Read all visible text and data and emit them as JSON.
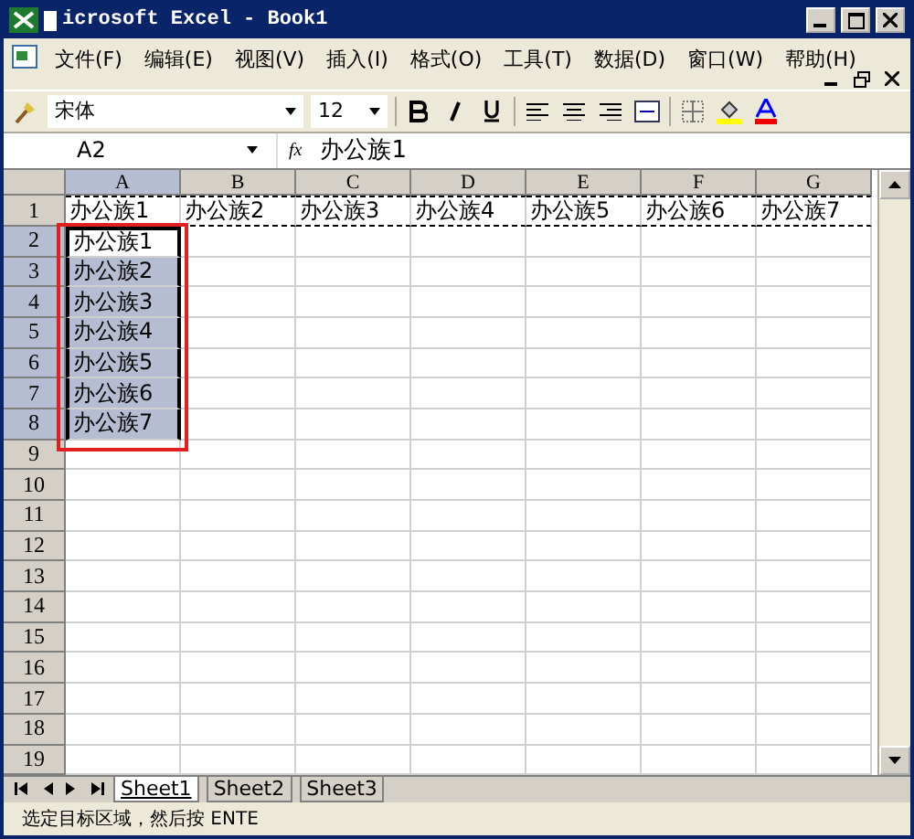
{
  "window": {
    "title": "icrosoft Excel - Book1"
  },
  "menu": [
    "文件(F)",
    "编辑(E)",
    "视图(V)",
    "插入(I)",
    "格式(O)",
    "工具(T)",
    "数据(D)",
    "窗口(W)",
    "帮助(H)"
  ],
  "toolbar": {
    "font": "宋体",
    "size": "12"
  },
  "formula_bar": {
    "name_box": "A2",
    "fx": "fx",
    "formula": "办公族1"
  },
  "columns": [
    {
      "label": "A",
      "selected": true
    },
    {
      "label": "B",
      "selected": false
    },
    {
      "label": "C",
      "selected": false
    },
    {
      "label": "D",
      "selected": false
    },
    {
      "label": "E",
      "selected": false
    },
    {
      "label": "F",
      "selected": false
    },
    {
      "label": "G",
      "selected": false
    }
  ],
  "rows": [
    {
      "header": "1",
      "selected": false,
      "copied": true,
      "cells": [
        "办公族1",
        "办公族2",
        "办公族3",
        "办公族4",
        "办公族5",
        "办公族6",
        "办公族7"
      ]
    },
    {
      "header": "2",
      "selected": true,
      "copied": false,
      "cells": [
        "办公族1"
      ]
    },
    {
      "header": "3",
      "selected": true,
      "copied": false,
      "cells": [
        "办公族2"
      ]
    },
    {
      "header": "4",
      "selected": true,
      "copied": false,
      "cells": [
        "办公族3"
      ]
    },
    {
      "header": "5",
      "selected": true,
      "copied": false,
      "cells": [
        "办公族4"
      ]
    },
    {
      "header": "6",
      "selected": true,
      "copied": false,
      "cells": [
        "办公族5"
      ]
    },
    {
      "header": "7",
      "selected": true,
      "copied": false,
      "cells": [
        "办公族6"
      ]
    },
    {
      "header": "8",
      "selected": true,
      "copied": false,
      "cells": [
        "办公族7"
      ]
    },
    {
      "header": "9",
      "selected": false,
      "copied": false,
      "cells": []
    },
    {
      "header": "10",
      "selected": false,
      "copied": false,
      "cells": []
    },
    {
      "header": "11",
      "selected": false,
      "copied": false,
      "cells": []
    },
    {
      "header": "12",
      "selected": false,
      "copied": false,
      "cells": []
    },
    {
      "header": "13",
      "selected": false,
      "copied": false,
      "cells": []
    },
    {
      "header": "14",
      "selected": false,
      "copied": false,
      "cells": []
    },
    {
      "header": "15",
      "selected": false,
      "copied": false,
      "cells": []
    },
    {
      "header": "16",
      "selected": false,
      "copied": false,
      "cells": []
    },
    {
      "header": "17",
      "selected": false,
      "copied": false,
      "cells": []
    },
    {
      "header": "18",
      "selected": false,
      "copied": false,
      "cells": []
    },
    {
      "header": "19",
      "selected": false,
      "copied": false,
      "cells": []
    }
  ],
  "sheet_tabs": [
    {
      "label": "Sheet1",
      "selected": true
    },
    {
      "label": "Sheet2",
      "selected": false
    },
    {
      "label": "Sheet3",
      "selected": false
    }
  ],
  "status_bar": "选定目标区域，然后按 ENTE"
}
